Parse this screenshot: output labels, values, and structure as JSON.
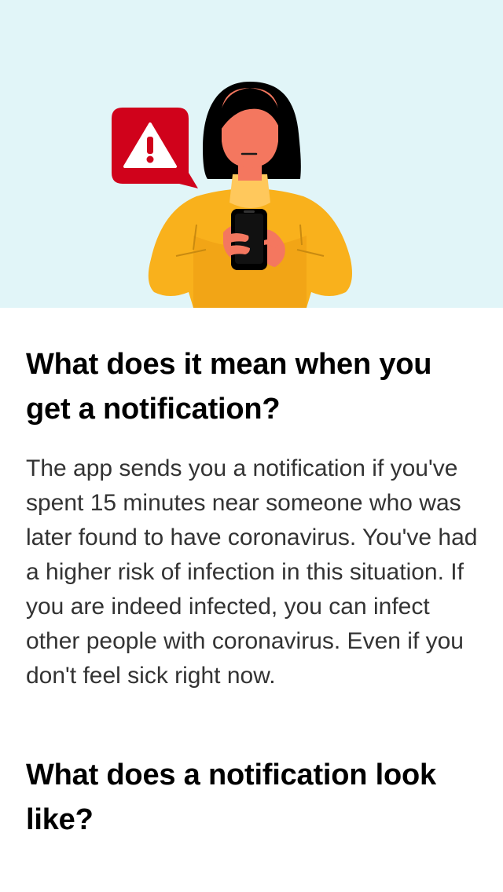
{
  "hero": {
    "illustration": "person-holding-phone-with-warning-alert",
    "alert_icon": "warning-triangle-icon",
    "colors": {
      "background": "#e1f5f8",
      "alert_red": "#d0021b",
      "sweater_yellow": "#f9b11c",
      "skin": "#f4775f",
      "hair": "#000000"
    }
  },
  "sections": [
    {
      "title": "What does it mean when you get a notification?",
      "body": "The app sends you a notification if you've spent 15 minutes near someone who was later found to have coronavirus. You've had a higher risk of infection in this situation. If you are indeed infected, you can infect other people with coronavirus. Even if you don't feel sick right now."
    },
    {
      "title": "What does a notification look like?"
    }
  ]
}
